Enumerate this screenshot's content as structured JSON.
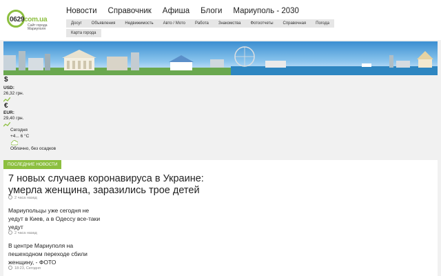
{
  "logo": {
    "name": "0629",
    "tld": "com.ua",
    "tagline": "Сайт города Мариуполя"
  },
  "main_nav": [
    "Новости",
    "Справочник",
    "Афиша",
    "Блоги",
    "Мариуполь - 2030"
  ],
  "sub_nav": [
    "Досуг",
    "Объявления",
    "Недвижимость",
    "Авто / Мото",
    "Работа",
    "Знакомства",
    "Фотоотчеты",
    "Справочная",
    "Погода",
    "Карта города"
  ],
  "currency": {
    "usd": {
      "icon": "$",
      "code": "USD:",
      "value": "26,32 грн."
    },
    "eur": {
      "icon": "€",
      "code": "EUR:",
      "value": "29,40 грн."
    }
  },
  "weather": {
    "label": "Сегодня",
    "temp": "+4... 6 °C",
    "desc": "Облачно, без осадков",
    "icon": "cloud-icon"
  },
  "news": {
    "tag": "ПОСЛЕДНИЕ НОВОСТИ",
    "lead": {
      "title": "7 новых случаев коронавируса в Украине: умерла женщина, заразились трое детей",
      "time": "2 часа назад"
    },
    "items": [
      {
        "title": "Мариупольцы уже сегодня не уедут в Киев, а в Одессу все-таки уедут",
        "time": "2 часа назад"
      },
      {
        "title": "В центре Мариуполя на пешеходном переходе сбили женщину, - ФОТО",
        "time": "18:23, Сегодня"
      }
    ]
  },
  "colors": {
    "accent": "#8cbf3f",
    "background": "#f1f1f1"
  }
}
